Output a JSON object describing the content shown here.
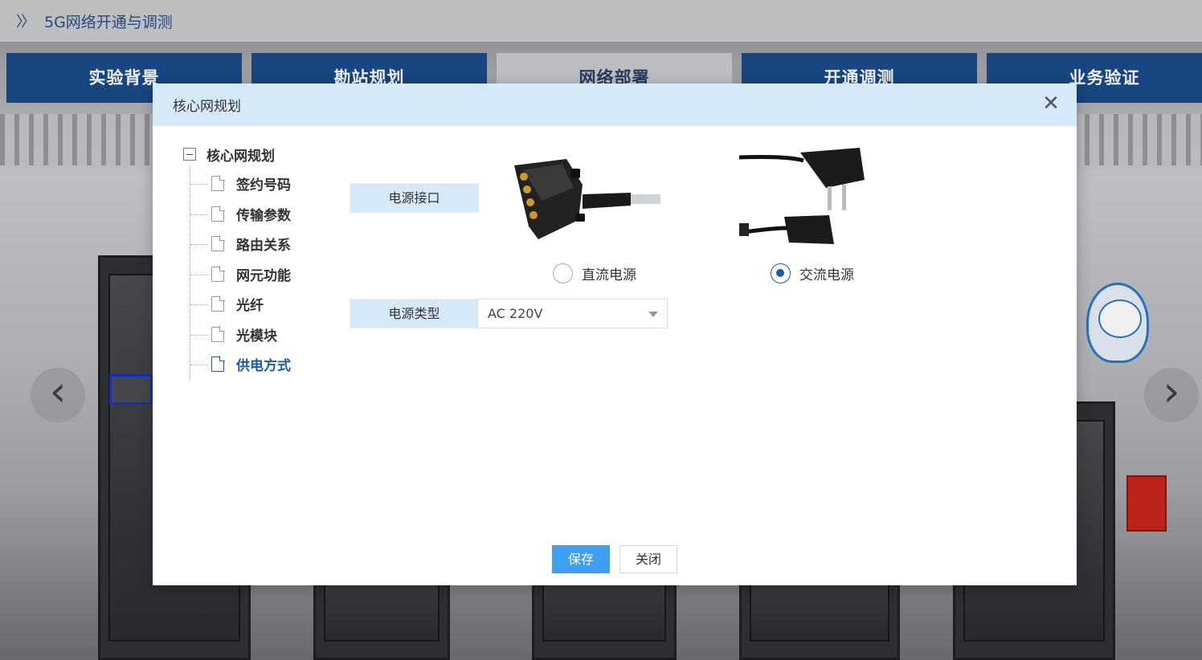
{
  "app": {
    "title": "5G网络开通与调测",
    "tabs": [
      {
        "label": "实验背景",
        "active": false
      },
      {
        "label": "勘站规划",
        "active": false
      },
      {
        "label": "网络部署",
        "active": true
      },
      {
        "label": "开通调测",
        "active": false
      },
      {
        "label": "业务验证",
        "active": false
      }
    ]
  },
  "modal": {
    "title": "核心网规划",
    "tree": {
      "root": "核心网规划",
      "items": [
        "签约号码",
        "传输参数",
        "路由关系",
        "网元功能",
        "光纤",
        "光模块",
        "供电方式"
      ],
      "selected_index": 6
    },
    "power_interface": {
      "label": "电源接口",
      "options": [
        {
          "label": "直流电源",
          "checked": false
        },
        {
          "label": "交流电源",
          "checked": true
        }
      ]
    },
    "power_type": {
      "label": "电源类型",
      "value": "AC 220V"
    },
    "buttons": {
      "save": "保存",
      "close": "关闭"
    }
  },
  "colors": {
    "tab_blue": "#1b4a8a",
    "header_blue": "#d6e9f8",
    "accent": "#1f5aa6",
    "save_button": "#3f9ff3"
  },
  "icons": [
    "double-chevron-right-icon",
    "close-icon",
    "collapse-minus-icon",
    "document-icon",
    "chevron-left-icon",
    "chevron-right-icon",
    "dropdown-caret-icon"
  ]
}
